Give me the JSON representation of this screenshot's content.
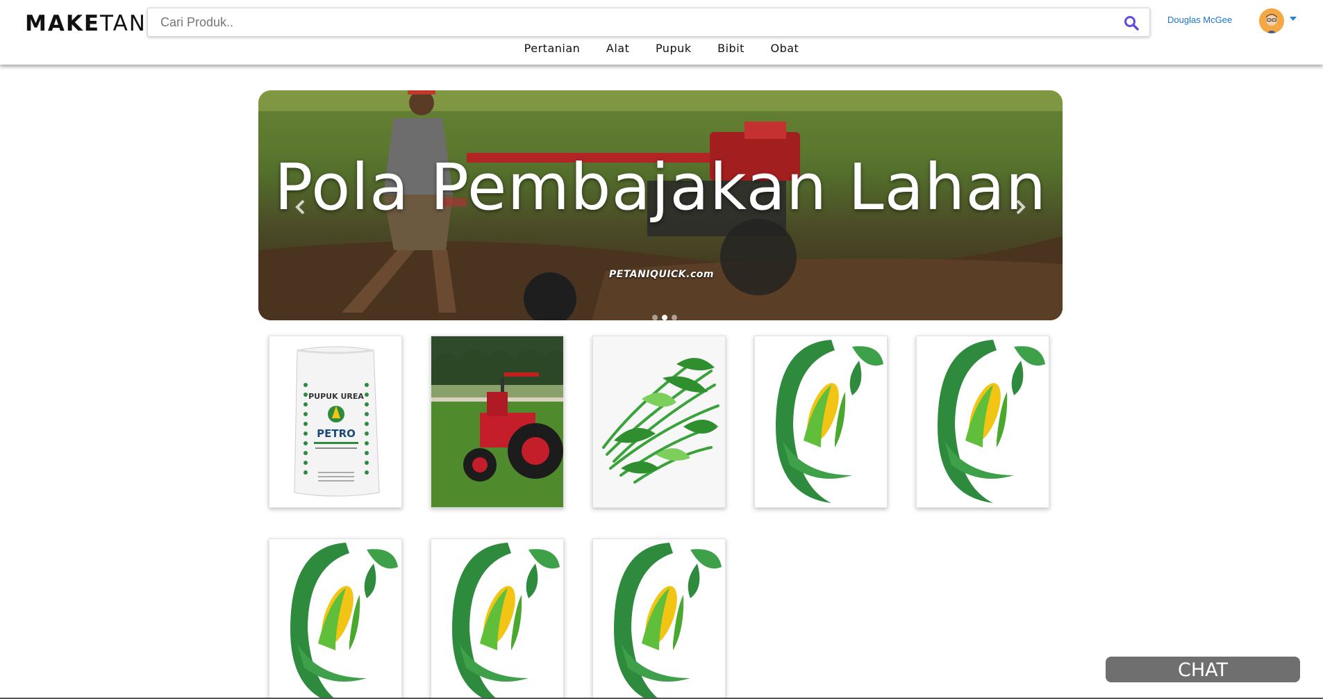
{
  "header": {
    "logo_bold": "MAKE",
    "logo_light": "TAN",
    "search_placeholder": "Cari Produk..",
    "user_name": "Douglas McGee"
  },
  "nav": {
    "items": [
      {
        "label": "Pertanian"
      },
      {
        "label": "Alat"
      },
      {
        "label": "Pupuk"
      },
      {
        "label": "Bibit"
      },
      {
        "label": "Obat"
      }
    ]
  },
  "carousel": {
    "title": "Pola Pembajakan Lahan",
    "watermark": "PETANIQUICK.com",
    "slide_count": 3,
    "active_slide": 2
  },
  "products": {
    "items": [
      {
        "image": "pupuk-urea-petro-bag",
        "bag_title": "PUPUK UREA",
        "bag_brand": "PETRO"
      },
      {
        "image": "red-tractor"
      },
      {
        "image": "kangkung-vegetable"
      },
      {
        "image": "corn-logo"
      },
      {
        "image": "corn-logo"
      },
      {
        "image": "corn-logo"
      },
      {
        "image": "corn-logo"
      },
      {
        "image": "corn-logo"
      }
    ]
  },
  "chat": {
    "label": "CHAT"
  },
  "colors": {
    "link": "#1a73c8",
    "search_icon": "#5b4fe0",
    "chat_bg": "#6f6f6f",
    "logo_green": "#2e8b3e",
    "corn_yellow": "#f2c515"
  }
}
